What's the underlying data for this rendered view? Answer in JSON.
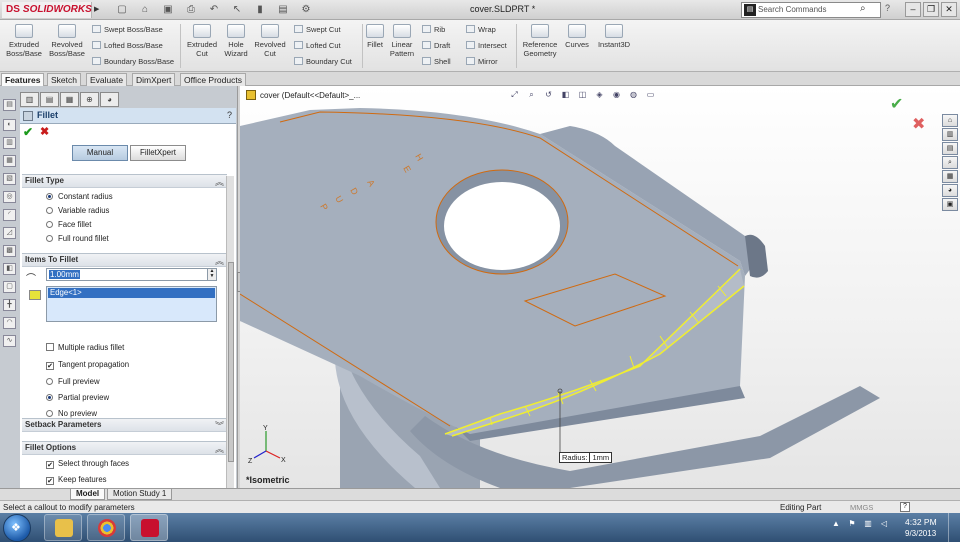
{
  "app": {
    "brand": "SOLIDWORKS",
    "document_title": "cover.SLDPRT *",
    "search_placeholder": "Search Commands",
    "help_icon": "question-icon"
  },
  "ribbon": {
    "extruded_boss": "Extruded Boss/Base",
    "revolved_boss": "Revolved Boss/Base",
    "swept_boss": "Swept Boss/Base",
    "lofted_boss": "Lofted Boss/Base",
    "boundary_boss": "Boundary Boss/Base",
    "extruded_cut": "Extruded Cut",
    "hole_wizard": "Hole Wizard",
    "revolved_cut": "Revolved Cut",
    "swept_cut": "Swept Cut",
    "lofted_cut": "Lofted Cut",
    "boundary_cut": "Boundary Cut",
    "fillet": "Fillet",
    "linear_pattern": "Linear Pattern",
    "rib": "Rib",
    "draft": "Draft",
    "shell": "Shell",
    "wrap": "Wrap",
    "intersect": "Intersect",
    "mirror": "Mirror",
    "reference_geometry": "Reference Geometry",
    "curves": "Curves",
    "instant3d": "Instant3D"
  },
  "tabs": [
    "Features",
    "Sketch",
    "Evaluate",
    "DimXpert",
    "Office Products"
  ],
  "property_manager": {
    "title": "Fillet",
    "help": "?",
    "manual_label": "Manual",
    "filletxpert_label": "FilletXpert",
    "fillet_type": {
      "title": "Fillet Type",
      "options": [
        "Constant radius",
        "Variable radius",
        "Face fillet",
        "Full round fillet"
      ],
      "selected": "Constant radius"
    },
    "items_to_fillet": {
      "title": "Items To Fillet",
      "radius_value": "1.00mm",
      "edge_item": "Edge<1>",
      "multiple_radius": "Multiple radius fillet",
      "tangent_propagation": "Tangent propagation",
      "full_preview": "Full preview",
      "partial_preview": "Partial preview",
      "no_preview": "No preview"
    },
    "setback_parameters": {
      "title": "Setback Parameters"
    },
    "fillet_options": {
      "title": "Fillet Options",
      "select_through_faces": "Select through faces",
      "keep_features": "Keep features"
    }
  },
  "viewport": {
    "tree_link": "cover  (Default<<Default>_...",
    "view_label": "*Isometric",
    "callout_label": "Radius:",
    "callout_value": "1mm",
    "model_text": [
      "H",
      "E",
      "A",
      "D",
      "U",
      "P"
    ],
    "colors": {
      "body": "#8f9aaa",
      "body_light": "#a6b0be",
      "edge": "#d06a10",
      "preview": "#e8e840"
    }
  },
  "bottom_tabs": [
    "Model",
    "Motion Study 1"
  ],
  "status": {
    "message": "Select a callout to modify parameters",
    "mode": "Editing Part",
    "units": "MMGS"
  },
  "taskbar": {
    "time": "4:32 PM",
    "date": "9/3/2013"
  }
}
